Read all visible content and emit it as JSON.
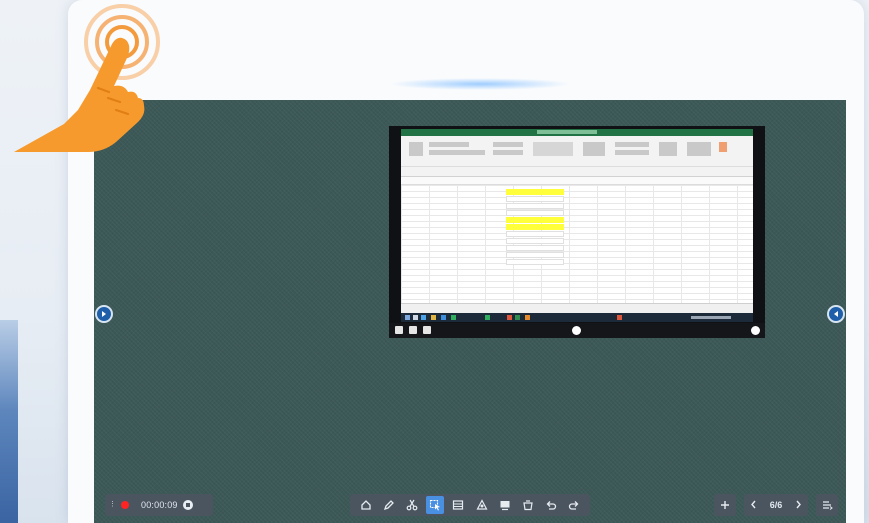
{
  "recording": {
    "menu_icon": "vertical-dots-icon",
    "status_icon": "record-dot-icon",
    "status_color": "#ff2424",
    "time": "00:00:09",
    "stop_icon": "stop-icon"
  },
  "toolbar": {
    "tools": [
      {
        "icon": "home-icon",
        "active": false
      },
      {
        "icon": "pen-icon",
        "active": false
      },
      {
        "icon": "scissors-icon",
        "active": false
      },
      {
        "icon": "select-pointer-icon",
        "active": true
      },
      {
        "icon": "table-icon",
        "active": false
      },
      {
        "icon": "shapes-icon",
        "active": false
      },
      {
        "icon": "board-icon",
        "active": false
      },
      {
        "icon": "eraser-icon",
        "active": false
      },
      {
        "icon": "undo-icon",
        "active": false
      },
      {
        "icon": "redo-icon",
        "active": false
      }
    ],
    "active_color": "#4a90e2"
  },
  "pager": {
    "add_icon": "plus-icon",
    "prev_icon": "chevron-left-icon",
    "label": "6/6",
    "next_icon": "chevron-right-icon",
    "menu_icon": "list-menu-icon"
  },
  "board": {
    "background_color": "#3c5957",
    "left_arrow_icon": "chevron-right-circle-icon",
    "right_arrow_icon": "chevron-left-circle-icon"
  },
  "capture": {
    "app": "spreadsheet",
    "highlight_color": "#ffff3b",
    "cells": [
      {
        "style": "yel"
      },
      {
        "style": "txt"
      },
      {
        "style": "txt"
      },
      {
        "style": "txt"
      },
      {
        "style": "yel"
      },
      {
        "style": "yel"
      },
      {
        "style": "txt"
      },
      {
        "style": "txt"
      },
      {
        "style": "txt"
      },
      {
        "style": "txt"
      },
      {
        "style": "txt"
      }
    ]
  },
  "overlay": {
    "icon": "tap-hand-icon",
    "color": "#f79a2d"
  }
}
